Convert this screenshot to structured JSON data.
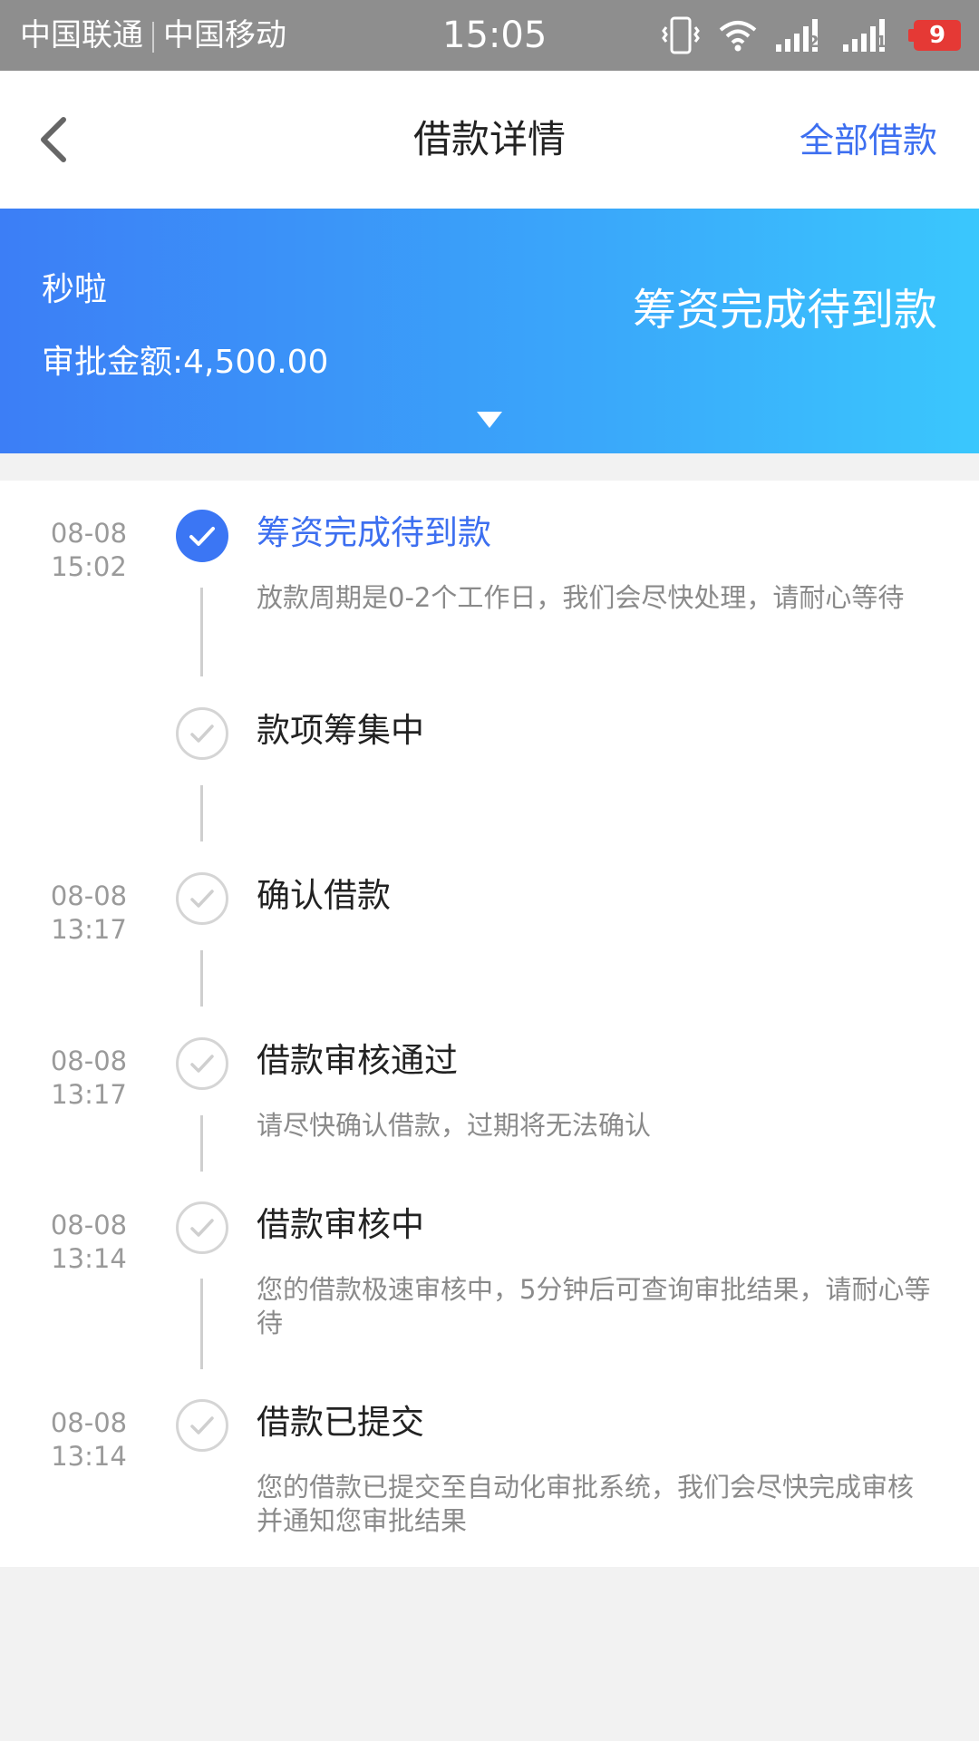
{
  "status_bar": {
    "carrier1": "中国联通",
    "carrier2": "中国移动",
    "time": "15:05",
    "battery": "9",
    "sim1_badge": "2",
    "sim2_badge": "1",
    "battery_color": "#e53935"
  },
  "header": {
    "back_icon": "chevron-left-icon",
    "title": "借款详情",
    "right_link": "全部借款"
  },
  "banner": {
    "product": "秒啦",
    "amount_label": "审批金额:",
    "amount_value": "4,500.00",
    "status": "筹资完成待到款",
    "expand_icon": "triangle-down-icon"
  },
  "timeline": {
    "steps": [
      {
        "date": "08-08",
        "time": "15:02",
        "title": "筹资完成待到款",
        "desc": "放款周期是0-2个工作日，我们会尽快处理，请耐心等待",
        "state": "active"
      },
      {
        "date": "",
        "time": "",
        "title": "款项筹集中",
        "desc": "",
        "state": "done"
      },
      {
        "date": "08-08",
        "time": "13:17",
        "title": "确认借款",
        "desc": "",
        "state": "done"
      },
      {
        "date": "08-08",
        "time": "13:17",
        "title": "借款审核通过",
        "desc": "请尽快确认借款，过期将无法确认",
        "state": "done"
      },
      {
        "date": "08-08",
        "time": "13:14",
        "title": "借款审核中",
        "desc": "您的借款极速审核中，5分钟后可查询审批结果，请耐心等待",
        "state": "done"
      },
      {
        "date": "08-08",
        "time": "13:14",
        "title": "借款已提交",
        "desc": "您的借款已提交至自动化审批系统，我们会尽快完成审核并通知您审批结果",
        "state": "done"
      }
    ]
  },
  "colors": {
    "accent": "#3d6ff0",
    "banner_gradient_start": "#3c7ef6",
    "banner_gradient_end": "#3ac7fd"
  }
}
